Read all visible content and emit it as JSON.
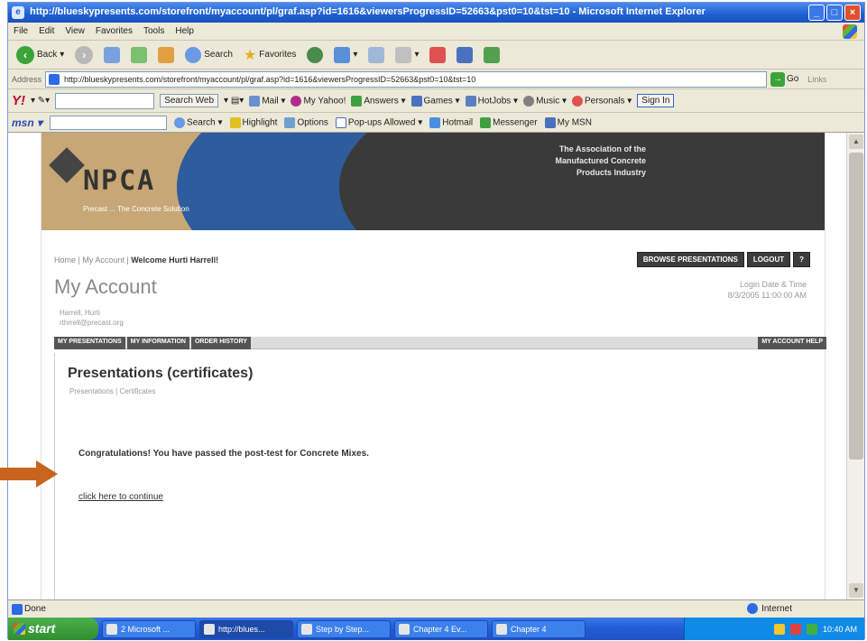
{
  "window": {
    "title": "http://blueskypresents.com/storefront/myaccount/pl/graf.asp?id=1616&viewersProgressID=52663&pst0=10&tst=10 - Microsoft Internet Explorer"
  },
  "menu": [
    "File",
    "Edit",
    "View",
    "Favorites",
    "Tools",
    "Help"
  ],
  "toolbar": {
    "back": "Back",
    "search": "Search",
    "favorites": "Favorites"
  },
  "address": {
    "label": "Address",
    "url": "http://blueskypresents.com/storefront/myaccount/pl/graf.asp?id=1616&viewersProgressID=52663&pst0=10&tst=10",
    "go": "Go",
    "links": "Links"
  },
  "yahoo": {
    "search_btn": "Search Web",
    "items": [
      "Mail",
      "My Yahoo!",
      "Answers",
      "Games",
      "HotJobs",
      "Music",
      "Personals"
    ],
    "sign_in": "Sign In"
  },
  "msn": {
    "items": [
      "Search",
      "Highlight",
      "Options",
      "Pop-ups Allowed",
      "Hotmail",
      "Messenger",
      "My MSN"
    ]
  },
  "banner": {
    "logo": "NPCA",
    "tagline": "Precast ... The Concrete Solution",
    "assoc_line1": "The Association of the",
    "assoc_line2": "Manufactured Concrete",
    "assoc_line3": "Products Industry"
  },
  "breadcrumb": {
    "path": "Home | My Account | ",
    "welcome": "Welcome Hurti Harrell!"
  },
  "top_buttons": {
    "browse": "BROWSE PRESENTATIONS",
    "logout": "LOGOUT"
  },
  "account": {
    "title": "My Account",
    "login_label": "Login Date & Time",
    "login_value": "8/3/2005 11:00:00 AM",
    "user_name": "Harrell, Hurti",
    "user_email": "rthrrell@precast.org"
  },
  "tabs": [
    "MY PRESENTATIONS",
    "MY INFORMATION",
    "ORDER HISTORY"
  ],
  "tab_right": "MY ACCOUNT HELP",
  "panel": {
    "heading": "Presentations (certificates)",
    "sub": "Presentations | Certificates",
    "message": "Congratulations! You have passed the post-test for Concrete Mixes.",
    "continue_link": "click here to continue"
  },
  "status": {
    "left": "Done",
    "zone": "Internet"
  },
  "taskbar": {
    "start": "start",
    "tasks": [
      "2 Microsoft ...",
      "http://blues...",
      "Step by Step...",
      "Chapter 4 Ev...",
      "Chapter 4"
    ],
    "time": "10:40 AM"
  },
  "colors": {
    "accent_arrow": "#c8641e",
    "banner_tan": "#c7a775",
    "banner_blue": "#2e5c9c"
  }
}
